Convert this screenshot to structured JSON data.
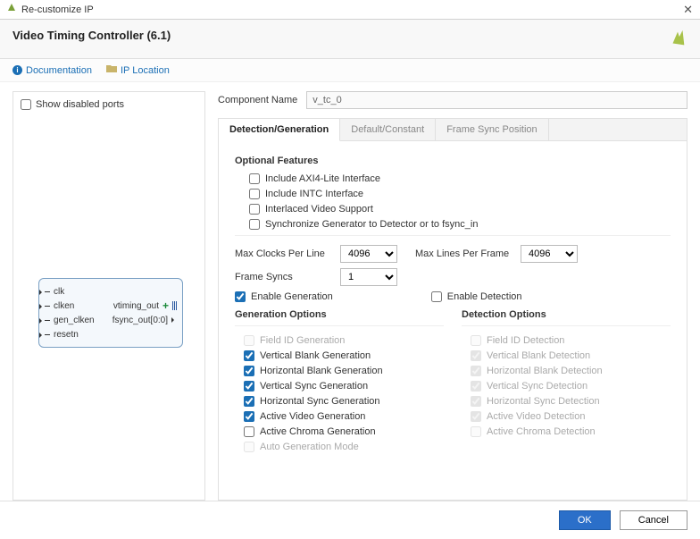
{
  "window": {
    "title": "Re-customize IP"
  },
  "header": {
    "title": "Video Timing Controller (6.1)"
  },
  "links": {
    "documentation": "Documentation",
    "ip_location": "IP Location"
  },
  "left": {
    "show_disabled": "Show disabled ports",
    "ports_in": [
      "clk",
      "clken",
      "gen_clken",
      "resetn"
    ],
    "ports_out": [
      "vtiming_out",
      "fsync_out[0:0]"
    ]
  },
  "component": {
    "label": "Component Name",
    "value": "v_tc_0"
  },
  "tabs": [
    "Detection/Generation",
    "Default/Constant",
    "Frame Sync Position"
  ],
  "optional": {
    "heading": "Optional Features",
    "items": [
      {
        "label": "Include AXI4-Lite Interface",
        "checked": false
      },
      {
        "label": "Include INTC Interface",
        "checked": false
      },
      {
        "label": "Interlaced Video Support",
        "checked": false
      },
      {
        "label": "Synchronize Generator to Detector or to fsync_in",
        "checked": false
      }
    ]
  },
  "config": {
    "max_clocks_label": "Max Clocks Per Line",
    "max_clocks_value": "4096",
    "max_lines_label": "Max Lines Per Frame",
    "max_lines_value": "4096",
    "frame_syncs_label": "Frame Syncs",
    "frame_syncs_value": "1",
    "enable_gen": "Enable Generation",
    "enable_det": "Enable Detection"
  },
  "gen": {
    "heading": "Generation Options",
    "items": [
      {
        "label": "Field ID Generation",
        "checked": false,
        "enabled": false
      },
      {
        "label": "Vertical Blank Generation",
        "checked": true,
        "enabled": true
      },
      {
        "label": "Horizontal Blank Generation",
        "checked": true,
        "enabled": true
      },
      {
        "label": "Vertical Sync Generation",
        "checked": true,
        "enabled": true
      },
      {
        "label": "Horizontal Sync Generation",
        "checked": true,
        "enabled": true
      },
      {
        "label": "Active Video Generation",
        "checked": true,
        "enabled": true
      },
      {
        "label": "Active Chroma Generation",
        "checked": false,
        "enabled": true
      },
      {
        "label": "Auto Generation Mode",
        "checked": false,
        "enabled": false
      }
    ]
  },
  "det": {
    "heading": "Detection Options",
    "items": [
      {
        "label": "Field ID Detection",
        "checked": false
      },
      {
        "label": "Vertical Blank Detection",
        "checked": true
      },
      {
        "label": "Horizontal Blank Detection",
        "checked": true
      },
      {
        "label": "Vertical Sync Detection",
        "checked": true
      },
      {
        "label": "Horizontal Sync Detection",
        "checked": true
      },
      {
        "label": "Active Video Detection",
        "checked": true
      },
      {
        "label": "Active Chroma Detection",
        "checked": false
      }
    ]
  },
  "footer": {
    "ok": "OK",
    "cancel": "Cancel"
  }
}
